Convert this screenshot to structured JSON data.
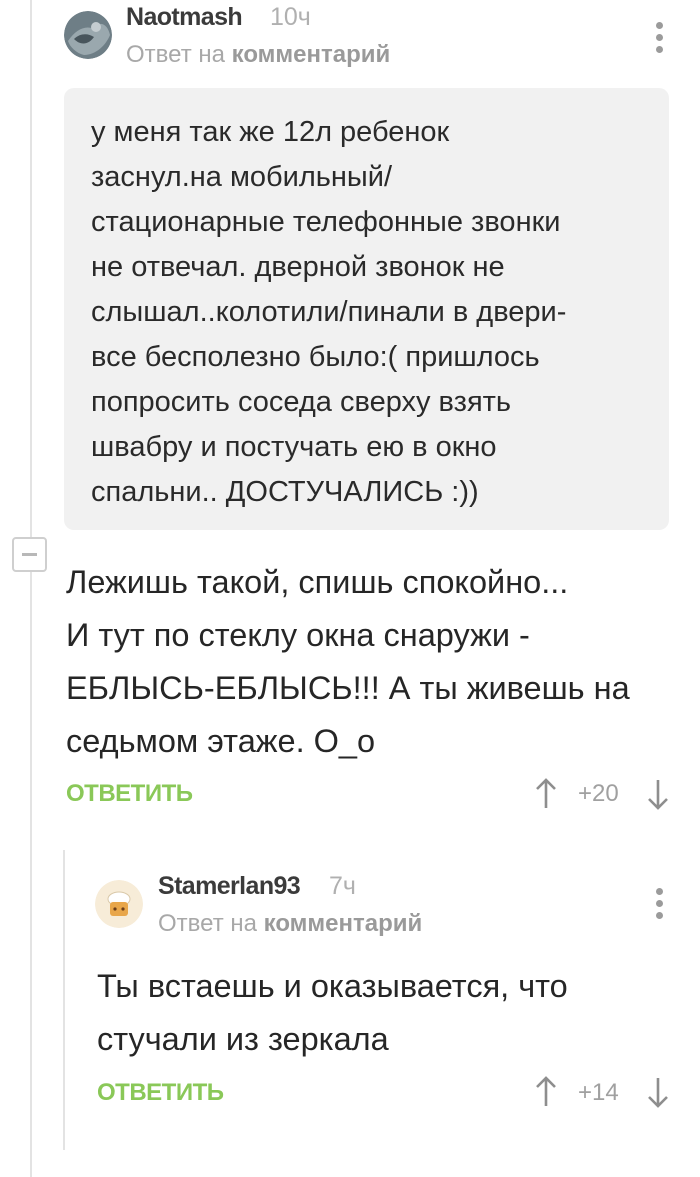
{
  "comment1": {
    "author": "Naotmash",
    "time": "10ч",
    "reply_prefix": "Ответ на",
    "reply_target": "комментарий",
    "quote_lines": [
      "у меня так же 12л ребенок",
      "заснул.на мобильный/",
      "стационарные телефонные звонки",
      "не отвечал. дверной звонок не",
      "слышал..колотили/пинали в двери-",
      "все бесполезно было:( пришлось",
      "попросить соседа сверху взять",
      "швабру и постучать ею в окно",
      "спальни.. ДОСТУЧАЛИСЬ :))"
    ],
    "body_lines": [
      "Лежишь такой, спишь спокойно...",
      "И тут по стеклу окна снаружи -",
      "ЕБЛЫСЬ-ЕБЛЫСЬ!!! А ты живешь на",
      "седьмом этаже. О_о"
    ],
    "reply_label": "ОТВЕТИТЬ",
    "score": "+20"
  },
  "comment2": {
    "author": "Stamerlan93",
    "time": "7ч",
    "reply_prefix": "Ответ на",
    "reply_target": "комментарий",
    "body_lines": [
      "Ты встаешь и оказывается, что",
      "стучали из зеркала"
    ],
    "reply_label": "ОТВЕТИТЬ",
    "score": "+14"
  },
  "icons": {
    "menu": "kebab-menu-icon",
    "collapse": "collapse-thread-icon",
    "upvote": "arrow-up-icon",
    "downvote": "arrow-down-icon"
  },
  "colors": {
    "accent_green": "#8ac858",
    "quote_bg": "#f1f1f1",
    "muted_text": "#a8a8a8"
  }
}
